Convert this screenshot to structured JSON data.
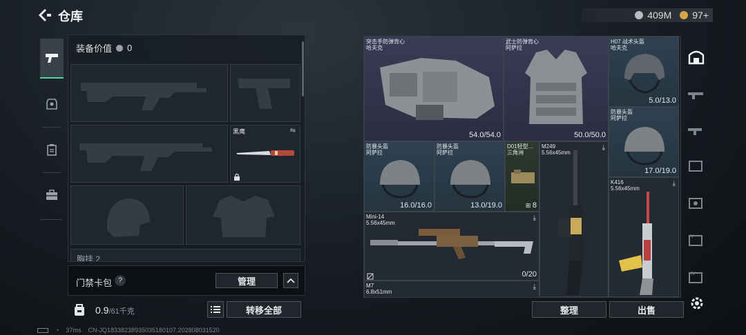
{
  "header": {
    "title": "仓库"
  },
  "currency": {
    "money": "409M",
    "tickets": "97+"
  },
  "loadout": {
    "value_label": "装备价值",
    "value": "0",
    "melee_name": "黑鹰",
    "partial_section_label": "胸挂 2"
  },
  "keycard": {
    "label": "门禁卡包",
    "help": "?",
    "manage": "管理"
  },
  "backpack": {
    "weight": "0.9",
    "capacity": "/61千克",
    "transfer_all": "转移全部"
  },
  "footer": {
    "ping": "37ms",
    "build": "CN-JQ18338238935035180107.202808031520"
  },
  "warehouse": {
    "items": [
      {
        "name": "突击手防弹背心\n哈夫克",
        "durability": "54.0/54.0"
      },
      {
        "name": "武士防弹背心\n阿萨拉",
        "durability": "50.0/50.0"
      },
      {
        "name": "H07 战术头盔\n哈夫克",
        "durability": "5.0/13.0"
      },
      {
        "name": "防暴头盔\n阿萨拉",
        "durability": "17.0/19.0"
      },
      {
        "name": "防暴头盔\n阿萨拉",
        "durability": "16.0/16.0"
      },
      {
        "name": "防暴头盔\n阿萨拉",
        "durability": "13.0/19.0"
      },
      {
        "name": "D01轻型...\n三角洲",
        "count": "8"
      },
      {
        "name": "M249\n5.56x45mm",
        "download": "⤓"
      },
      {
        "name": "K416\n5.56x45mm",
        "download": "⤓"
      },
      {
        "name": "Mini-14\n5.56x45mm",
        "ammo": "0/20",
        "download": "⤓"
      },
      {
        "name": "M7\n6.8x51mm",
        "download": "⤓"
      }
    ],
    "sort": "整理",
    "sell": "出售"
  },
  "colors": {
    "accent": "#4fd3a0",
    "rarity_purple": "#3a3b55",
    "rarity_blue": "#2f4150",
    "rarity_green": "#2d3a30"
  }
}
